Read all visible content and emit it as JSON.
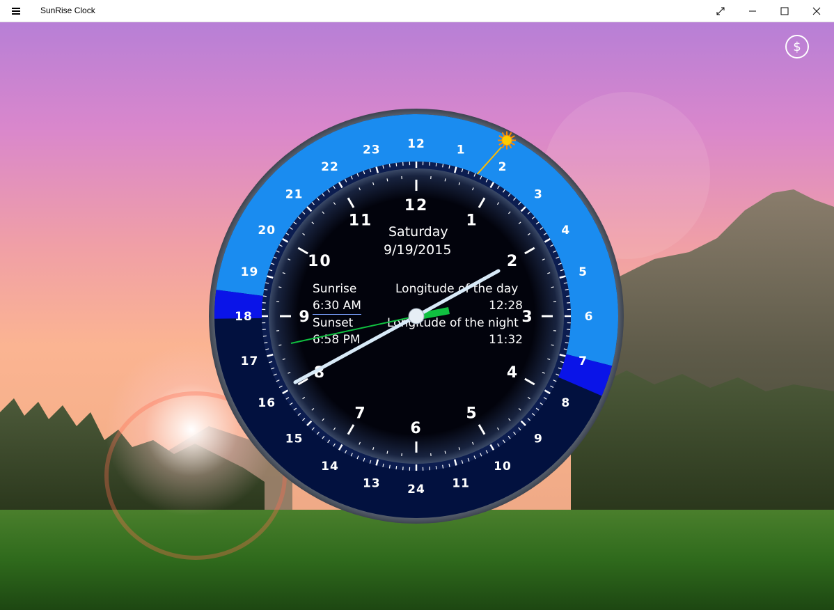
{
  "window": {
    "title": "SunRise Clock",
    "menu_icon": "hamburger-icon",
    "buttons": [
      "expand-icon",
      "minimize-icon",
      "maximize-icon",
      "close-icon"
    ]
  },
  "toolbar": {
    "purchase_symbol": "$",
    "purchase_icon": "dollar-circle-icon"
  },
  "clock": {
    "day": "Saturday",
    "date": "9/19/2015",
    "sunrise_label": "Sunrise",
    "sunrise_time": "6:30 AM",
    "sunset_label": "Sunset",
    "sunset_time": "6:58 PM",
    "day_length_label": "Longitude of the day",
    "day_length": "12:28",
    "night_length_label": "Longitude of the night",
    "night_length": "11:32",
    "hour_numbers_12": [
      "12",
      "1",
      "2",
      "3",
      "4",
      "5",
      "6",
      "7",
      "8",
      "9",
      "10",
      "11"
    ],
    "hour_numbers_24": [
      "24",
      "13",
      "14",
      "15",
      "16",
      "17",
      "18",
      "19",
      "20",
      "21",
      "22",
      "23",
      "12",
      "1",
      "2",
      "3",
      "4",
      "5",
      "6",
      "7",
      "8",
      "9",
      "10",
      "11"
    ],
    "colors": {
      "day_band": "#1a8cf0",
      "twilight_band": "#0a14e8",
      "night_band": "#02113f",
      "face": "#02030c",
      "accent_hand": "#10c040",
      "sun": "#ffcc00"
    },
    "sun_icon": "sun-icon"
  }
}
